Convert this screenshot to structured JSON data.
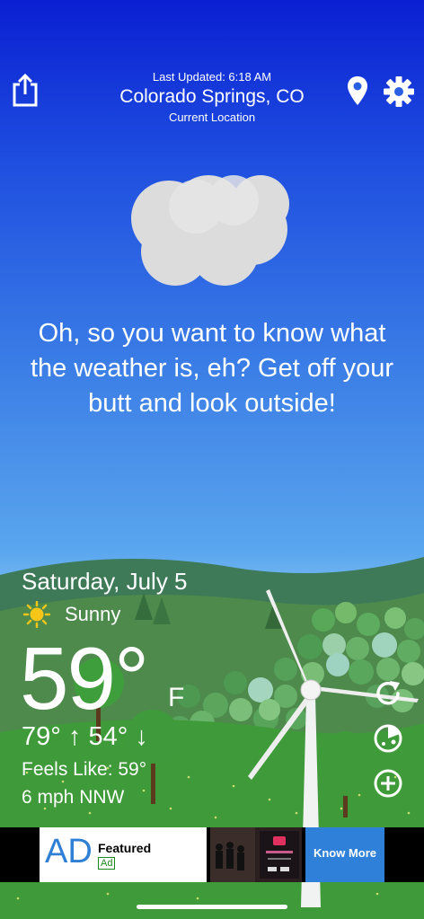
{
  "header": {
    "last_updated": "Last Updated: 6:18 AM",
    "city": "Colorado Springs, CO",
    "location_label": "Current Location",
    "share_icon": "share-icon",
    "location_icon": "location-pin-icon",
    "settings_icon": "gear-icon"
  },
  "main": {
    "snark_text": "Oh, so you want to know what the weather is, eh? Get off your butt and look outside!",
    "condition_icon": "cloud-icon"
  },
  "weather": {
    "date": "Saturday, July 5",
    "condition": "Sunny",
    "condition_icon": "sun-icon",
    "temperature": "59°",
    "unit": "F",
    "hi_lo": "79° ↑ 54° ↓",
    "feels_like": "Feels Like: 59°",
    "wind": "6 mph NNW"
  },
  "side_controls": {
    "refresh_icon": "refresh-icon",
    "radar_icon": "radar-icon",
    "add_icon": "plus-circle-icon"
  },
  "ad": {
    "logo": "AD",
    "title": "Featured",
    "tag": "Ad",
    "cta": "Know More"
  },
  "colors": {
    "sky_top": "#0a1fd2",
    "sky_bottom": "#b6dcf5",
    "hill": "#3f8f3f",
    "ad_accent": "#2f80d8"
  }
}
